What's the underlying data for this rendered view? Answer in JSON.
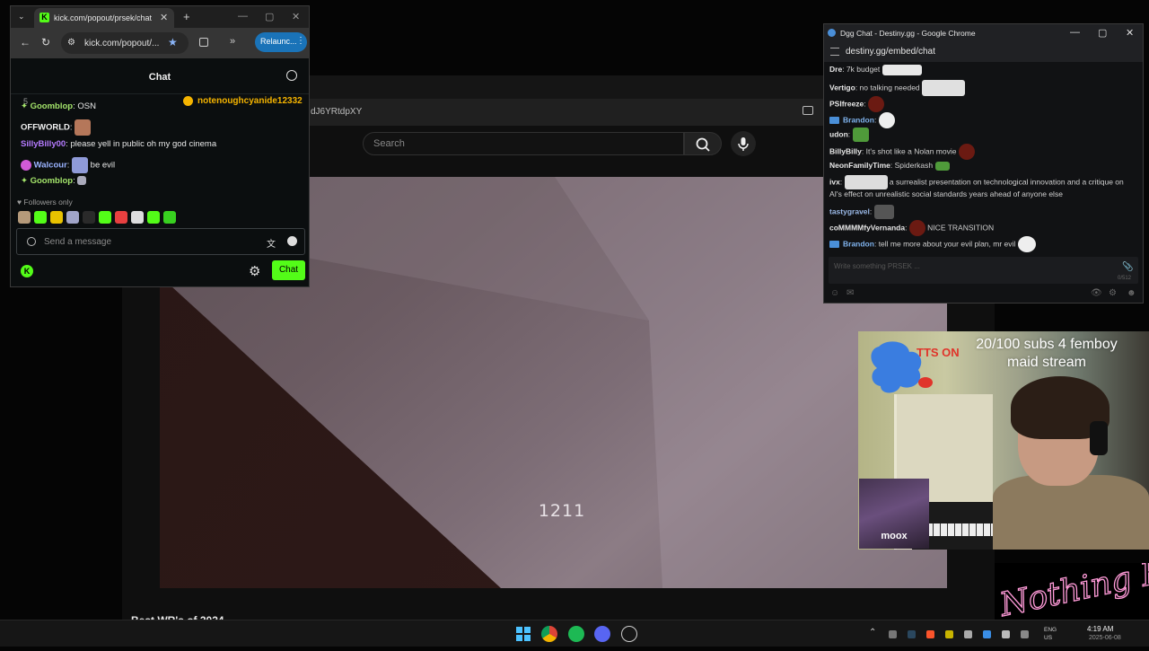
{
  "youtube": {
    "url_fragment": "dJ6YRtdpXY",
    "search_placeholder": "Search",
    "video_counter": "1211",
    "below_title": "Best WR's of 2024"
  },
  "kick": {
    "tab_title": "kick.com/popout/prsek/chat",
    "tab_close": "✕",
    "new_tab": "+",
    "url": "kick.com/popout/...",
    "relaunch": "Relaunc...",
    "chat_title": "Chat",
    "pinned_count": "5",
    "pinned_user": "notenoughcyanide12332",
    "messages": [
      {
        "user": "Goomblop",
        "text": " OSN",
        "color": "#a3e36a"
      },
      {
        "user": "OFFWORLD",
        "text": "",
        "color": "#f2f2f2"
      },
      {
        "user": "SillyBilly00",
        "text": " please yell in public oh my god cinema",
        "color": "#b57bff"
      },
      {
        "user": "Walcour",
        "text": " be evil",
        "color": "#9ab3ff"
      },
      {
        "user": "Goomblop",
        "text": "",
        "color": "#a3e36a"
      }
    ],
    "followers_only": "♥ Followers only",
    "input_placeholder": "Send a message",
    "chat_button": "Chat",
    "accent": "#53fc18"
  },
  "dgg": {
    "window_title": "Dgg Chat - Destiny.gg - Google Chrome",
    "url": "destiny.gg/embed/chat",
    "messages": [
      {
        "user": "Dre",
        "text": " 7k budget"
      },
      {
        "user": "Vertigo",
        "text": " no talking needed"
      },
      {
        "user": "PSIfreeze",
        "text": ""
      },
      {
        "user": "Brandon",
        "text": ""
      },
      {
        "user": "udon",
        "text": ""
      },
      {
        "user": "BillyBilly",
        "text": " It's shot like a Nolan movie"
      },
      {
        "user": "NeonFamilyTime",
        "text": " Spiderkash"
      },
      {
        "user": "ivx",
        "text": " a surrealist presentation on technological innovation and a critique on"
      },
      {
        "user": "",
        "text": "AI's effect on unrealistic social standards years ahead of anyone else"
      },
      {
        "user": "tastygravel",
        "text": ""
      },
      {
        "user": "coMMMMfyVernanda",
        "text": " NICE TRANSITION"
      },
      {
        "user": "Brandon",
        "text": " tell me more about your evil plan, mr evil"
      }
    ],
    "input_placeholder": "Write something PRSEK ...",
    "char_counter": "0/512"
  },
  "overlay": {
    "tts_text": "TTS ON",
    "subs_line1": "20/100 subs 4 femboy",
    "subs_line2": "maid stream",
    "moox": "moox",
    "logo_text": "Nothing Else?"
  },
  "taskbar": {
    "time": "4:19 AM",
    "date": "2025-06-08",
    "lang1": "ENG",
    "lang2": "US"
  }
}
